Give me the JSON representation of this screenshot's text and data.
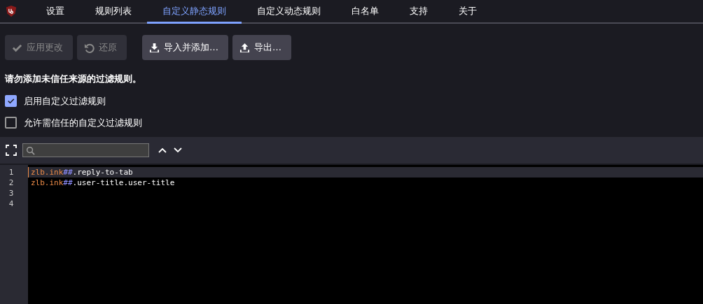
{
  "tabs": [
    {
      "label": "设置",
      "selected": false
    },
    {
      "label": "规则列表",
      "selected": false
    },
    {
      "label": "自定义静态规则",
      "selected": true
    },
    {
      "label": "自定义动态规则",
      "selected": false
    },
    {
      "label": "白名单",
      "selected": false
    },
    {
      "label": "支持",
      "selected": false
    },
    {
      "label": "关于",
      "selected": false
    }
  ],
  "actions": [
    {
      "label": "应用更改",
      "kind": "apply",
      "disabled": true
    },
    {
      "label": "还原",
      "kind": "revert",
      "disabled": true
    },
    {
      "label": "导入并添加…",
      "kind": "import",
      "disabled": false
    },
    {
      "label": "导出…",
      "kind": "export",
      "disabled": false
    }
  ],
  "warning": "请勿添加未信任来源的过滤规则。",
  "options": [
    {
      "label": "启用自定义过滤规则",
      "checked": true
    },
    {
      "label": "允许需信任的自定义过滤规则",
      "checked": false
    }
  ],
  "editor": {
    "lines": [
      {
        "number": "1",
        "selected": true,
        "tokens": [
          {
            "kind": "host",
            "text": "zlb.ink"
          },
          {
            "kind": "separator",
            "text": "##"
          },
          {
            "kind": "selector",
            "text": ".reply-to-tab"
          }
        ]
      },
      {
        "number": "2",
        "selected": false,
        "tokens": [
          {
            "kind": "host",
            "text": "zlb.ink"
          },
          {
            "kind": "separator",
            "text": "##"
          },
          {
            "kind": "selector",
            "text": ".user-title.user-title"
          }
        ]
      },
      {
        "number": "3",
        "selected": false
      },
      {
        "number": "4",
        "selected": false
      }
    ]
  }
}
